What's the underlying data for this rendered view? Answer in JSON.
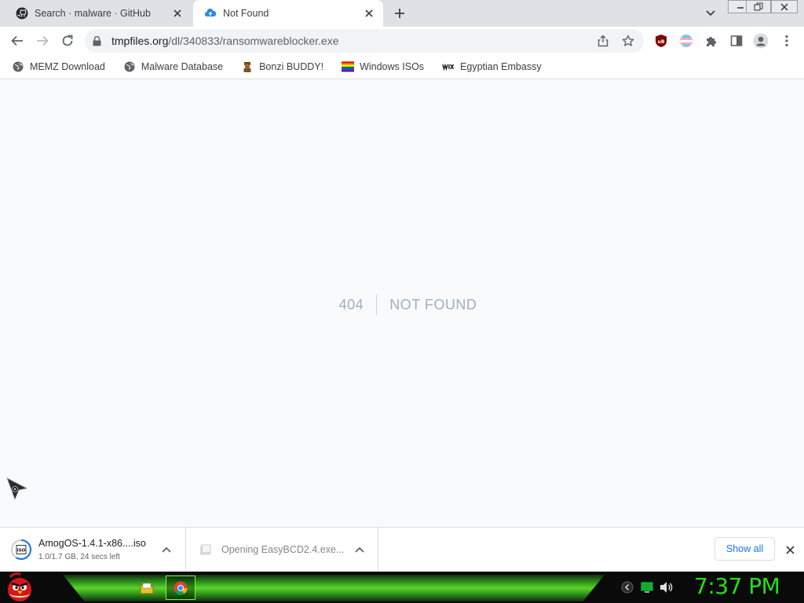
{
  "tabs": [
    {
      "title": "Search · malware · GitHub",
      "favicon": "github-icon",
      "active": false
    },
    {
      "title": "Not Found",
      "favicon": "cloud-upload-icon",
      "active": true
    }
  ],
  "toolbar": {
    "url_host": "tmpfiles.org",
    "url_path": "/dl/340833/ransomwareblocker.exe"
  },
  "bookmarks": [
    {
      "label": "MEMZ Download",
      "icon": "globe-icon"
    },
    {
      "label": "Malware Database",
      "icon": "globe-icon"
    },
    {
      "label": "Bonzi BUDDY!",
      "icon": "bonzi-icon"
    },
    {
      "label": "Windows ISOs",
      "icon": "rainbow-flag-icon"
    },
    {
      "label": "Egyptian Embassy",
      "icon": "wix-icon"
    }
  ],
  "page": {
    "code": "404",
    "message": "Not Found"
  },
  "downloads": [
    {
      "name": "AmogOS-1.4.1-x86....iso",
      "status": "1.0/1.7 GB, 24 secs left"
    },
    {
      "name": "Opening EasyBCD2.4.exe...",
      "status": ""
    }
  ],
  "shelf": {
    "show_all": "Show all"
  },
  "taskbar": {
    "clock": "7:37 PM"
  },
  "colors": {
    "tabstrip": "#dee1e6",
    "accent": "#1a73e8",
    "clock": "#22e016",
    "taskbar_green": "#5bd42a"
  }
}
